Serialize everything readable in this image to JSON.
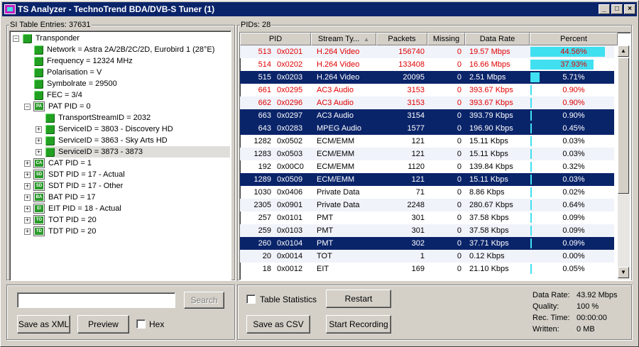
{
  "window": {
    "title": "TS Analyzer - TechnoTrend BDA/DVB-S Tuner (1)",
    "min": "_",
    "max": "□",
    "close": "×"
  },
  "si_panel": {
    "label": "SI Table Entries: 37631",
    "tree": [
      {
        "text": "Transponder",
        "icon": "green-cube-icon"
      },
      {
        "text": "Network = Astra 2A/2B/2C/2D, Eurobird 1 (28°E)",
        "icon": "green-cube-icon"
      },
      {
        "text": "Frequency = 12324 MHz",
        "icon": "green-cube-icon"
      },
      {
        "text": "Polarisation = V",
        "icon": "green-cube-icon"
      },
      {
        "text": "Symbolrate = 29500",
        "icon": "green-cube-icon"
      },
      {
        "text": "FEC = 3/4",
        "icon": "green-cube-icon"
      },
      {
        "text": "PAT PID = 0",
        "icon": "table-icon",
        "tag": "PA"
      },
      {
        "text": "TransportStreamID = 2032",
        "icon": "green-cube-icon"
      },
      {
        "text": "ServiceID = 3803 - Discovery HD",
        "icon": "green-cube-icon"
      },
      {
        "text": "ServiceID = 3863 - Sky Arts HD",
        "icon": "green-cube-icon"
      },
      {
        "text": "ServiceID = 3873 - 3873",
        "icon": "green-cube-icon"
      },
      {
        "text": "CAT PID = 1",
        "icon": "table-icon",
        "tag": "CA"
      },
      {
        "text": "SDT PID = 17 - Actual",
        "icon": "table-icon",
        "tag": "SD"
      },
      {
        "text": "SDT PID = 17 - Other",
        "icon": "table-icon",
        "tag": "SD"
      },
      {
        "text": "BAT PID = 17",
        "icon": "table-icon",
        "tag": "BA"
      },
      {
        "text": "EIT PID = 18 - Actual",
        "icon": "table-icon",
        "tag": "EI"
      },
      {
        "text": "TOT PID = 20",
        "icon": "table-icon",
        "tag": "TO"
      },
      {
        "text": "TDT PID = 20",
        "icon": "table-icon",
        "tag": "TD"
      }
    ],
    "search_value": "",
    "search_button": "Search",
    "save_xml_button": "Save as XML",
    "preview_button": "Preview",
    "hex_label": "Hex"
  },
  "pid_panel": {
    "label": "PIDs: 28",
    "columns": [
      "PID",
      "Stream Ty...",
      "Packets",
      "Missing",
      "Data Rate",
      "Percent"
    ],
    "sort_indicator": "▲",
    "rows": [
      {
        "pid": "513",
        "hex": "0x0201",
        "type": "H.264 Video",
        "packets": "156740",
        "missing": "0",
        "rate": "19.57 Mbps",
        "percent": "44.56%",
        "pct": 44.56,
        "style": "red"
      },
      {
        "pid": "514",
        "hex": "0x0202",
        "type": "H.264 Video",
        "packets": "133408",
        "missing": "0",
        "rate": "16.66 Mbps",
        "percent": "37.93%",
        "pct": 37.93,
        "style": "red"
      },
      {
        "pid": "515",
        "hex": "0x0203",
        "type": "H.264 Video",
        "packets": "20095",
        "missing": "0",
        "rate": "2.51 Mbps",
        "percent": "5.71%",
        "pct": 5.71,
        "style": "sel"
      },
      {
        "pid": "661",
        "hex": "0x0295",
        "type": "AC3 Audio",
        "packets": "3153",
        "missing": "0",
        "rate": "393.67 Kbps",
        "percent": "0.90%",
        "pct": 0.9,
        "style": "red"
      },
      {
        "pid": "662",
        "hex": "0x0296",
        "type": "AC3 Audio",
        "packets": "3153",
        "missing": "0",
        "rate": "393.67 Kbps",
        "percent": "0.90%",
        "pct": 0.9,
        "style": "red"
      },
      {
        "pid": "663",
        "hex": "0x0297",
        "type": "AC3 Audio",
        "packets": "3154",
        "missing": "0",
        "rate": "393.79 Kbps",
        "percent": "0.90%",
        "pct": 0.9,
        "style": "sel"
      },
      {
        "pid": "643",
        "hex": "0x0283",
        "type": "MPEG Audio",
        "packets": "1577",
        "missing": "0",
        "rate": "196.90 Kbps",
        "percent": "0.45%",
        "pct": 0.45,
        "style": "sel"
      },
      {
        "pid": "1282",
        "hex": "0x0502",
        "type": "ECM/EMM",
        "packets": "121",
        "missing": "0",
        "rate": "15.11 Kbps",
        "percent": "0.03%",
        "pct": 0.03,
        "style": "normal"
      },
      {
        "pid": "1283",
        "hex": "0x0503",
        "type": "ECM/EMM",
        "packets": "121",
        "missing": "0",
        "rate": "15.11 Kbps",
        "percent": "0.03%",
        "pct": 0.03,
        "style": "normal"
      },
      {
        "pid": "192",
        "hex": "0x00C0",
        "type": "ECM/EMM",
        "packets": "1120",
        "missing": "0",
        "rate": "139.84 Kbps",
        "percent": "0.32%",
        "pct": 0.32,
        "style": "normal"
      },
      {
        "pid": "1289",
        "hex": "0x0509",
        "type": "ECM/EMM",
        "packets": "121",
        "missing": "0",
        "rate": "15.11 Kbps",
        "percent": "0.03%",
        "pct": 0.03,
        "style": "sel"
      },
      {
        "pid": "1030",
        "hex": "0x0406",
        "type": "Private Data",
        "packets": "71",
        "missing": "0",
        "rate": "8.86 Kbps",
        "percent": "0.02%",
        "pct": 0.02,
        "style": "normal"
      },
      {
        "pid": "2305",
        "hex": "0x0901",
        "type": "Private Data",
        "packets": "2248",
        "missing": "0",
        "rate": "280.67 Kbps",
        "percent": "0.64%",
        "pct": 0.64,
        "style": "normal"
      },
      {
        "pid": "257",
        "hex": "0x0101",
        "type": "PMT",
        "packets": "301",
        "missing": "0",
        "rate": "37.58 Kbps",
        "percent": "0.09%",
        "pct": 0.09,
        "style": "normal"
      },
      {
        "pid": "259",
        "hex": "0x0103",
        "type": "PMT",
        "packets": "301",
        "missing": "0",
        "rate": "37.58 Kbps",
        "percent": "0.09%",
        "pct": 0.09,
        "style": "normal"
      },
      {
        "pid": "260",
        "hex": "0x0104",
        "type": "PMT",
        "packets": "302",
        "missing": "0",
        "rate": "37.71 Kbps",
        "percent": "0.09%",
        "pct": 0.09,
        "style": "sel"
      },
      {
        "pid": "20",
        "hex": "0x0014",
        "type": "TOT",
        "packets": "1",
        "missing": "0",
        "rate": "0.12 Kbps",
        "percent": "0.00%",
        "pct": 0.0,
        "style": "normal"
      },
      {
        "pid": "18",
        "hex": "0x0012",
        "type": "EIT",
        "packets": "169",
        "missing": "0",
        "rate": "21.10 Kbps",
        "percent": "0.05%",
        "pct": 0.05,
        "style": "normal"
      }
    ],
    "table_statistics_label": "Table Statistics",
    "restart_button": "Restart",
    "save_csv_button": "Save as CSV",
    "start_recording_button": "Start Recording",
    "stats": {
      "data_rate_label": "Data Rate:",
      "data_rate_value": "43.92 Mbps",
      "quality_label": "Quality:",
      "quality_value": "100 %",
      "rec_time_label": "Rec. Time:",
      "rec_time_value": "00:00:00",
      "written_label": "Written:",
      "written_value": "0 MB"
    }
  }
}
